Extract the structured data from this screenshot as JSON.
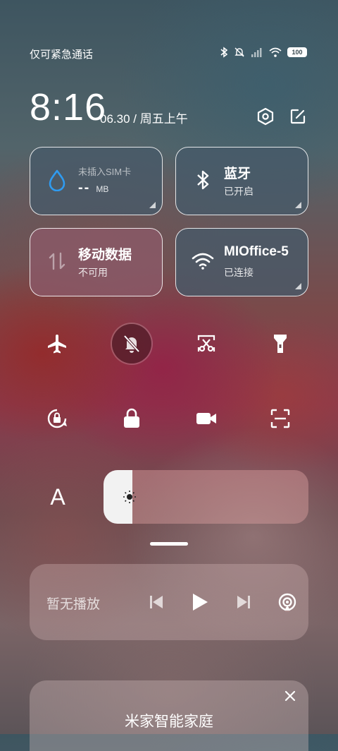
{
  "status": {
    "carrier_text": "仅可紧急通话",
    "battery": "100"
  },
  "header": {
    "time": "8:16",
    "date": "06.30 / 周五上午"
  },
  "tiles": {
    "data_usage": {
      "title": "未插入SIM卡",
      "value": "--",
      "unit": "MB"
    },
    "bluetooth": {
      "title": "蓝牙",
      "status": "已开启"
    },
    "mobile_data": {
      "title": "移动数据",
      "status": "不可用"
    },
    "wifi": {
      "title": "MIOffice-5",
      "status": "已连接"
    }
  },
  "toggles": [
    {
      "name": "airplane-mode",
      "active": false
    },
    {
      "name": "mute",
      "active": true
    },
    {
      "name": "screenshot",
      "active": false
    },
    {
      "name": "flashlight",
      "active": false
    },
    {
      "name": "auto-rotate",
      "active": false
    },
    {
      "name": "lock-screen",
      "active": false
    },
    {
      "name": "screen-record",
      "active": false
    },
    {
      "name": "scanner",
      "active": false
    }
  ],
  "font_toggle_label": "A",
  "brightness": {
    "level": 0.14
  },
  "media": {
    "label": "暂无播放"
  },
  "card": {
    "title": "米家智能家庭"
  }
}
